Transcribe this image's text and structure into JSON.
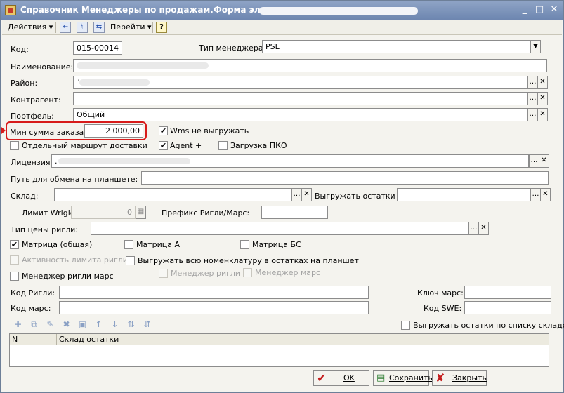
{
  "window": {
    "title": "Справочник Менеджеры по продажам.Форма элемента:",
    "controls": {
      "minimize": "_",
      "maximize": "□",
      "close": "✕"
    }
  },
  "toolbar": {
    "actions_label": "Действия",
    "goto_label": "Перейти",
    "help_label": "?"
  },
  "form": {
    "code_label": "Код:",
    "code_value": "015-00014",
    "manager_type_label": "Тип менеджера:",
    "manager_type_value": "PSL",
    "name_label": "Наименование:",
    "district_label": "Район:",
    "district_value": "´",
    "counterparty_label": "Контрагент:",
    "portfolio_label": "Портфель:",
    "portfolio_value": "Общий",
    "min_order_label": "Мин сумма заказа:",
    "min_order_value": "2 000,00",
    "wms_label": "Wms не выгружать",
    "wms_checked": true,
    "separate_route_label": "Отдельный маршрут доставки",
    "separate_route_checked": false,
    "agent_label": "Agent +",
    "agent_checked": true,
    "pko_label": "Загрузка ПКО",
    "pko_checked": false,
    "licenses_label": "Лицензия:",
    "licenses_value": ".",
    "tablet_path_label": "Путь для обмена на планшете:",
    "warehouse_label": "Склад:",
    "upload_stock_label": "Выгружать остатки ...",
    "wrigley_limit_label": "Лимит Wrigley",
    "wrigley_limit_value": "0",
    "wrigley_prefix_label": "Префикс Ригли/Марс:",
    "price_type_label": "Тип цены ригли:",
    "matrix_common_label": "Матрица (общая)",
    "matrix_common_checked": true,
    "matrix_a_label": "Матрица А",
    "matrix_a_checked": false,
    "matrix_bs_label": "Матрица БС",
    "matrix_bs_checked": false,
    "limit_activity_label": "Активность лимита ригли",
    "upload_all_label": "Выгружать всю номенклатуру в остатках на планшет",
    "upload_all_checked": false,
    "manager_wrigley_mars_label": "Менеджер ригли марс",
    "manager_wrigley_mars_checked": false,
    "manager_wrigley_label": "Менеджер ригли",
    "manager_mars_label": "Менеджер марс",
    "wrigley_code_label": "Код Ригли:",
    "mars_key_label": "Ключ марс:",
    "mars_code_label": "Код марс:",
    "swe_code_label": "Код SWE:",
    "upload_by_list_label": "Выгружать остатки по списку складов",
    "upload_by_list_checked": false
  },
  "table": {
    "columns": [
      "N",
      "Склад остатки"
    ]
  },
  "buttons": {
    "ok_label": "OK",
    "save_label": "Сохранить",
    "close_label": "Закрыть"
  },
  "colors": {
    "highlight": "#d71b1b",
    "titlebar": "#7f96be"
  }
}
